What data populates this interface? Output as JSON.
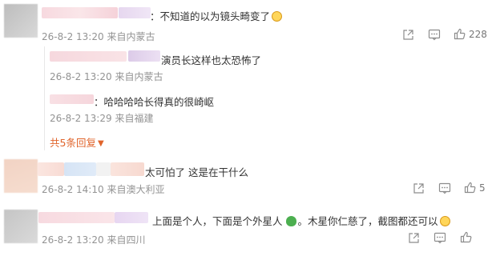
{
  "comments": [
    {
      "text": "：不知道的以为镜头畸变了",
      "date": "26-8-2 13:20",
      "location": "来自内蒙古",
      "likes": "228"
    },
    {
      "text": "太可怕了 这是在干什么",
      "date": "26-8-2 14:10",
      "location": "来自澳大利亚",
      "likes": "5"
    },
    {
      "text_a": "上面是个人，下面是个外星人",
      "text_b": "。木星你仁慈了，截图都还可以",
      "date": "26-8-2 13:20",
      "location": "来自四川"
    }
  ],
  "replies": [
    {
      "text": "演员长这样也太恐怖了",
      "date": "26-8-2 13:20",
      "location": "来自内蒙古"
    },
    {
      "text": "：哈哈哈哈长得真的很崎岖",
      "date": "26-8-2 13:29",
      "location": "来自福建"
    }
  ],
  "reply_summary": "共5条回复",
  "icons": {
    "share": "share-icon",
    "comment": "comment-icon",
    "like": "like-icon",
    "expand": "caret-down-icon",
    "laugh_emoji": "laugh-emoji-icon",
    "alien_emoji": "alien-emoji-icon"
  },
  "colors": {
    "accent": "#e0642b",
    "meta": "#939393"
  }
}
